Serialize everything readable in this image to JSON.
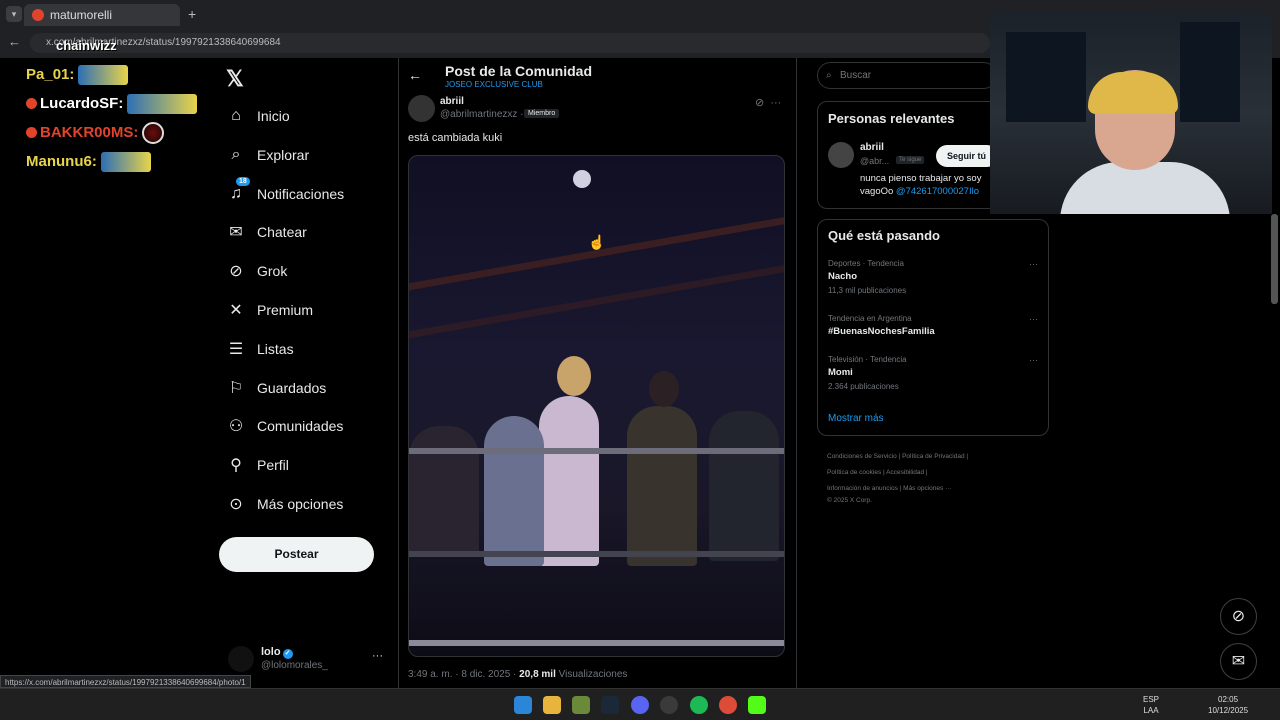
{
  "browser": {
    "tab_title": "matumorelli",
    "url": "x.com/abrilmartinezxz/status/1997921338640699684",
    "status_url": "https://x.com/abrilmartinezxz/status/1997921338640699684/photo/1"
  },
  "overlay": {
    "chat": [
      {
        "user": "Pa_01:",
        "color": "#e8d44a"
      },
      {
        "user": "LucardoSF:",
        "color": "#ffffff"
      },
      {
        "user": "BAKKR00MS:",
        "color": "#e0442c"
      },
      {
        "user": "Manunu6:",
        "color": "#e8d44a"
      }
    ],
    "stream_name": "chainwizz"
  },
  "sidebar": {
    "items": [
      {
        "label": "Inicio",
        "icon": "home-icon",
        "glyph": "⌂"
      },
      {
        "label": "Explorar",
        "icon": "search-icon",
        "glyph": "⌕"
      },
      {
        "label": "Notificaciones",
        "icon": "bell-icon",
        "glyph": "♫",
        "badge": "18"
      },
      {
        "label": "Chatear",
        "icon": "mail-icon",
        "glyph": "✉"
      },
      {
        "label": "Grok",
        "icon": "grok-icon",
        "glyph": "⊘"
      },
      {
        "label": "Premium",
        "icon": "x-icon",
        "glyph": "✕"
      },
      {
        "label": "Listas",
        "icon": "list-icon",
        "glyph": "☰"
      },
      {
        "label": "Guardados",
        "icon": "bookmark-icon",
        "glyph": "⚐"
      },
      {
        "label": "Comunidades",
        "icon": "people-icon",
        "glyph": "⚇"
      },
      {
        "label": "Perfil",
        "icon": "person-icon",
        "glyph": "⚲"
      },
      {
        "label": "Más opciones",
        "icon": "more-circle-icon",
        "glyph": "⊙"
      }
    ],
    "post_label": "Postear",
    "account": {
      "name": "lolo",
      "handle": "@lolomorales_"
    }
  },
  "main": {
    "header_title": "Post de la Comunidad",
    "header_sub": "JOSEO EXCLUSIVE CLUB",
    "author_name": "abriil",
    "author_handle": "@abrilmartinezxz ·",
    "member_label": "Miembro",
    "text": "está cambiada kuki",
    "time": "3:49 a. m. · 8 dic. 2025 ·",
    "views_count": "20,8 mil",
    "views_label": "Visualizaciones"
  },
  "right": {
    "search_placeholder": "Buscar",
    "relevant_title": "Personas relevantes",
    "relevant": {
      "name": "abriil",
      "handle": "@abr...",
      "follows_you": "Te sigue",
      "follow_label": "Seguir tú",
      "bio": "nunca pienso trabajar yo soy vagoOo",
      "bio_link": "@742617000027Ilo"
    },
    "trends_title": "Qué está pasando",
    "trends": [
      {
        "category": "Deportes · Tendencia",
        "title": "Nacho",
        "count": "11,3 mil publicaciones"
      },
      {
        "category": "Tendencia en Argentina",
        "title": "#BuenasNochesFamilia",
        "count": ""
      },
      {
        "category": "Televisión · Tendencia",
        "title": "Momi",
        "count": "2.364 publicaciones"
      }
    ],
    "show_more": "Mostrar más",
    "footer": [
      "Condiciones de Servicio",
      "|",
      "Política de Privacidad",
      "|",
      "Política de cookies",
      "|",
      "Accesibilidad",
      "|",
      "Información de anuncios",
      "|",
      "Más opciones ···",
      "© 2025 X Corp."
    ]
  },
  "taskbar": {
    "lang": "ESP",
    "lang2": "LAA",
    "time": "02:05",
    "date": "10/12/2025"
  },
  "colors": {
    "accent": "#1d9bf0",
    "background": "#000000",
    "border": "#2f3336"
  }
}
